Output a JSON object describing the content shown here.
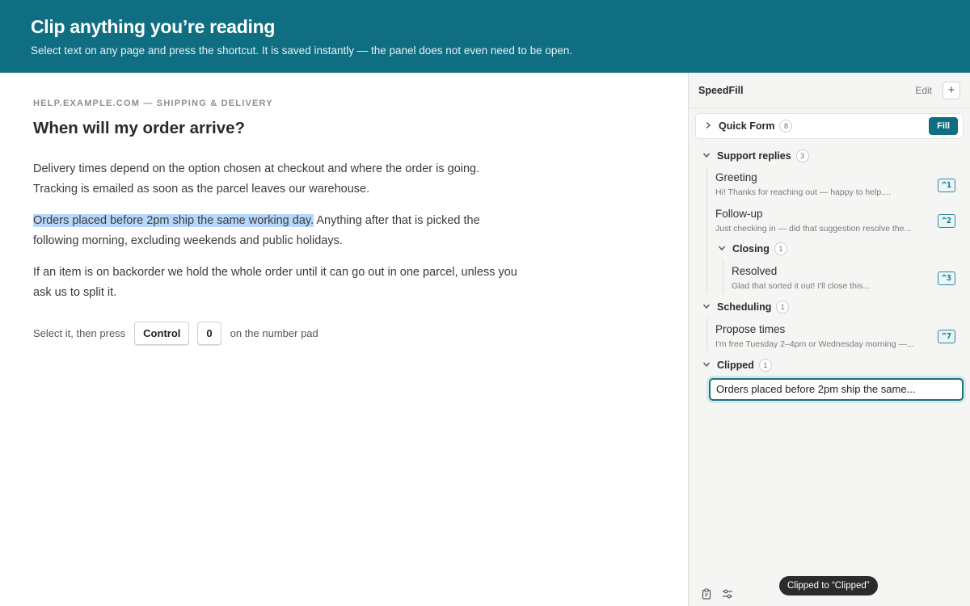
{
  "banner": {
    "title": "Clip anything you’re reading",
    "subtitle": "Select text on any page and press the shortcut. It is saved instantly — the panel does not even need to be open."
  },
  "article": {
    "eyebrow": "HELP.EXAMPLE.COM — SHIPPING & DELIVERY",
    "heading": "When will my order arrive?",
    "para1": "Delivery times depend on the option chosen at checkout and where the order is going. Tracking is emailed as soon as the parcel leaves our warehouse.",
    "para2_highlight": "Orders placed before 2pm ship the same working day.",
    "para2_rest": " Anything after that is picked the following morning, excluding weekends and public holidays.",
    "para3": "If an item is on backorder we hold the whole order until it can go out in one parcel, unless you ask us to split it.",
    "instruction_prefix": "Select it, then press",
    "key1": "Control",
    "key2": "0",
    "instruction_suffix": "on the number pad"
  },
  "panel": {
    "title": "SpeedFill",
    "edit_label": "Edit",
    "add_label": "+",
    "quick_form": {
      "label": "Quick Form",
      "count": "8",
      "fill_label": "Fill"
    },
    "support": {
      "label": "Support replies",
      "count": "3"
    },
    "greeting": {
      "title": "Greeting",
      "snippet": "Hi! Thanks for reaching out — happy to help....",
      "shortcut": "^1"
    },
    "followup": {
      "title": "Follow-up",
      "snippet": "Just checking in — did that suggestion resolve the...",
      "shortcut": "^2"
    },
    "closing": {
      "label": "Closing",
      "count": "1"
    },
    "resolved": {
      "title": "Resolved",
      "snippet": "Glad that sorted it out! I'll close this...",
      "shortcut": "^3"
    },
    "scheduling": {
      "label": "Scheduling",
      "count": "1"
    },
    "propose": {
      "title": "Propose times",
      "snippet": "I'm free Tuesday 2–4pm or Wednesday morning —...",
      "shortcut": "^7"
    },
    "clipped": {
      "label": "Clipped",
      "count": "1",
      "item_value": "Orders placed before 2pm ship the same..."
    }
  },
  "toast": {
    "text": "Clipped to “Clipped”"
  },
  "colors": {
    "accent": "#0f6e82",
    "highlight": "#b6d7fb",
    "panel_bg": "#f5f5f3"
  },
  "icons": [
    "chevron-right-icon",
    "chevron-down-icon",
    "clipboard-icon",
    "sliders-icon"
  ]
}
